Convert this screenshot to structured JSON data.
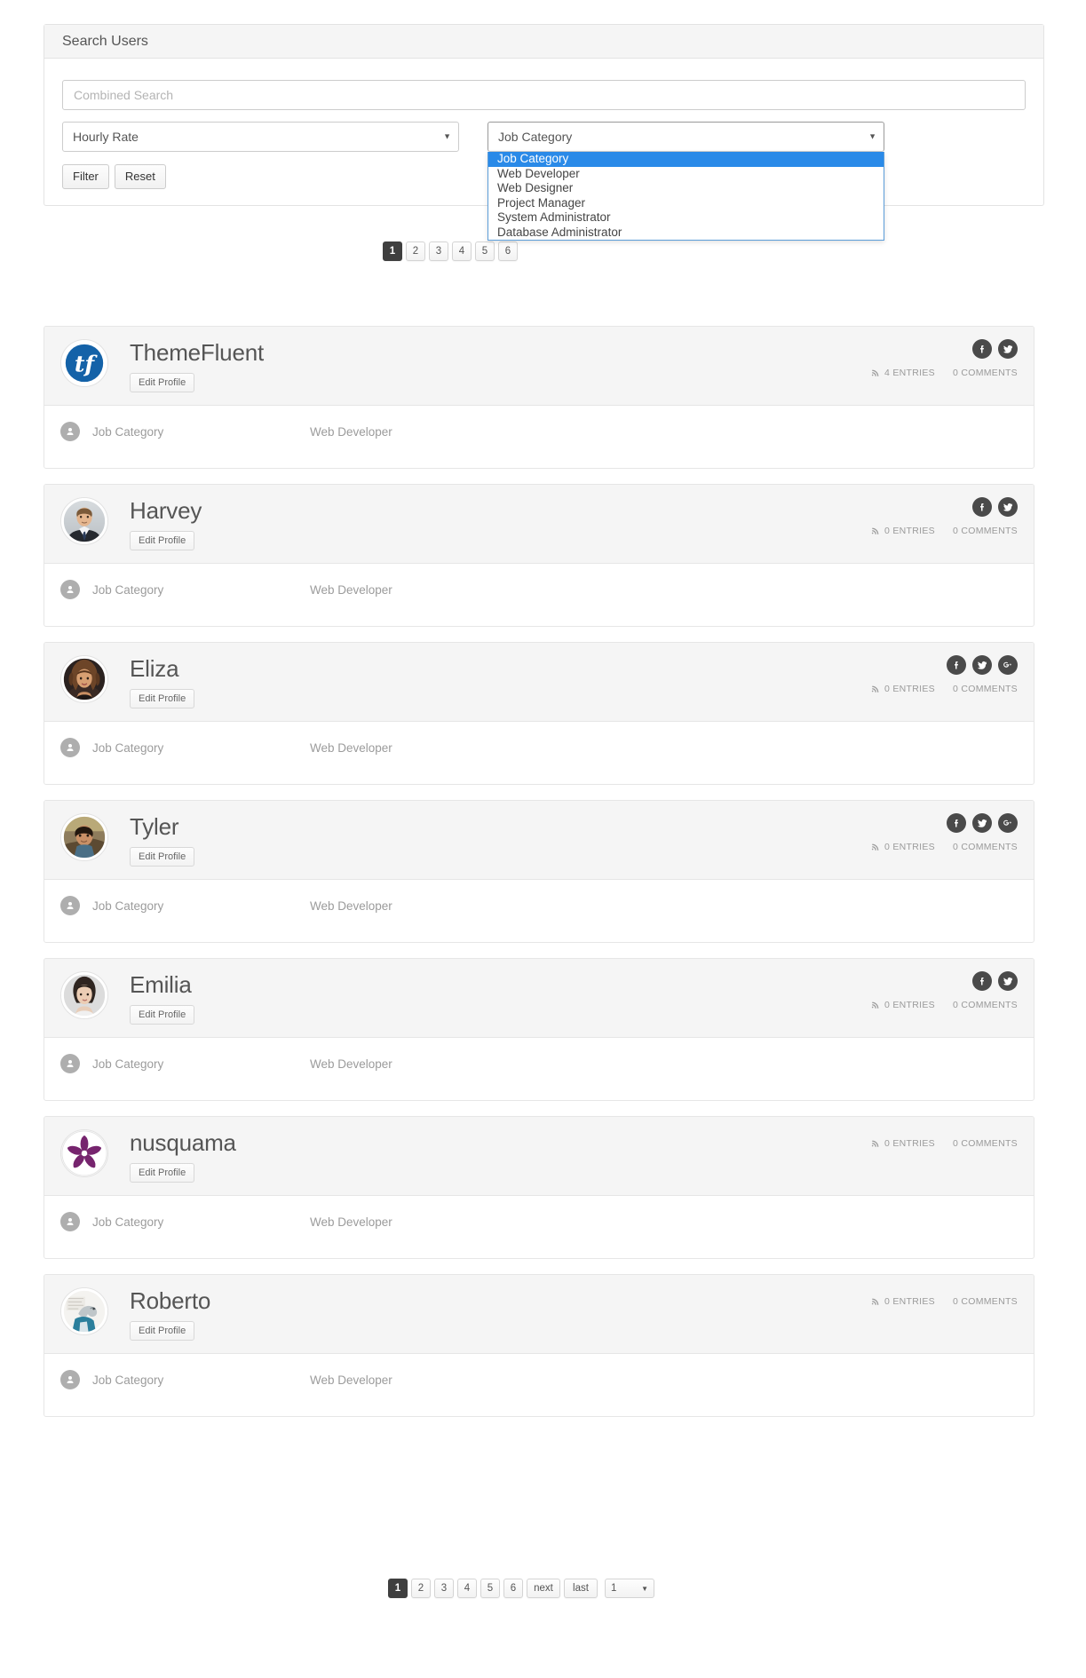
{
  "search": {
    "title": "Search Users",
    "combined_placeholder": "Combined Search",
    "hourly_rate_value": "Hourly Rate",
    "job_category_value": "Job Category",
    "job_category_options": [
      "Job Category",
      "Web Developer",
      "Web Designer",
      "Project Manager",
      "System Administrator",
      "Database Administrator"
    ],
    "selected_option_index": 0,
    "filter_label": "Filter",
    "reset_label": "Reset",
    "highlight_color": "#2a8ae8"
  },
  "pagination_top": {
    "pages": [
      "1",
      "2",
      "3",
      "4",
      "5",
      "6"
    ],
    "active": "1"
  },
  "pagination_bottom": {
    "pages": [
      "1",
      "2",
      "3",
      "4",
      "5",
      "6"
    ],
    "active": "1",
    "next_label": "next",
    "last_label": "last",
    "page_select_value": "1"
  },
  "labels": {
    "edit_profile": "Edit Profile",
    "attribute_label": "Job Category"
  },
  "users": [
    {
      "name": "ThemeFluent",
      "avatar": "themefluent-logo",
      "entries": "4 ENTRIES",
      "comments": "0 COMMENTS",
      "socials": [
        "facebook-icon",
        "twitter-icon"
      ],
      "attr_label": "Job Category",
      "attr_value": "Web Developer"
    },
    {
      "name": "Harvey",
      "avatar": "photo-man-suit",
      "entries": "0 ENTRIES",
      "comments": "0 COMMENTS",
      "socials": [
        "facebook-icon",
        "twitter-icon"
      ],
      "attr_label": "Job Category",
      "attr_value": "Web Developer"
    },
    {
      "name": "Eliza",
      "avatar": "photo-woman-curly",
      "entries": "0 ENTRIES",
      "comments": "0 COMMENTS",
      "socials": [
        "facebook-icon",
        "twitter-icon",
        "googleplus-icon"
      ],
      "attr_label": "Job Category",
      "attr_value": "Web Developer"
    },
    {
      "name": "Tyler",
      "avatar": "photo-man-outdoor",
      "entries": "0 ENTRIES",
      "comments": "0 COMMENTS",
      "socials": [
        "facebook-icon",
        "twitter-icon",
        "googleplus-icon"
      ],
      "attr_label": "Job Category",
      "attr_value": "Web Developer"
    },
    {
      "name": "Emilia",
      "avatar": "photo-woman-portrait",
      "entries": "0 ENTRIES",
      "comments": "0 COMMENTS",
      "socials": [
        "facebook-icon",
        "twitter-icon"
      ],
      "attr_label": "Job Category",
      "attr_value": "Web Developer"
    },
    {
      "name": "nusquama",
      "avatar": "purple-flower-logo",
      "entries": "0 ENTRIES",
      "comments": "0 COMMENTS",
      "socials": [],
      "attr_label": "Job Category",
      "attr_value": "Web Developer"
    },
    {
      "name": "Roberto",
      "avatar": "photo-sketch-bird",
      "entries": "0 ENTRIES",
      "comments": "0 COMMENTS",
      "socials": [],
      "attr_label": "Job Category",
      "attr_value": "Web Developer"
    }
  ]
}
